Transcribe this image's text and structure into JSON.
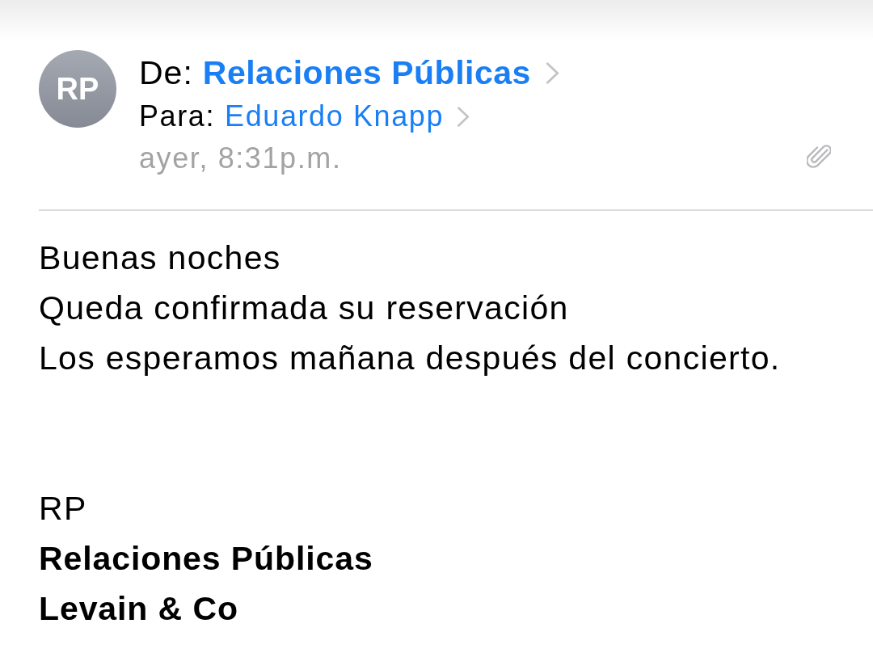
{
  "header": {
    "avatar": {
      "initials": "RP"
    },
    "from": {
      "label": "De:",
      "name": "Relaciones Públicas"
    },
    "to": {
      "label": "Para:",
      "name": "Eduardo Knapp"
    },
    "date": "ayer, 8:31p.m.",
    "has_attachment": true
  },
  "body_lines": [
    "Buenas noches",
    "Queda confirmada su reservación",
    "Los esperamos mañana después del concierto."
  ],
  "signature_lines": [
    {
      "text": "RP",
      "bold": false
    },
    {
      "text": "Relaciones Públicas",
      "bold": true
    },
    {
      "text": "Levain & Co",
      "bold": true
    }
  ]
}
